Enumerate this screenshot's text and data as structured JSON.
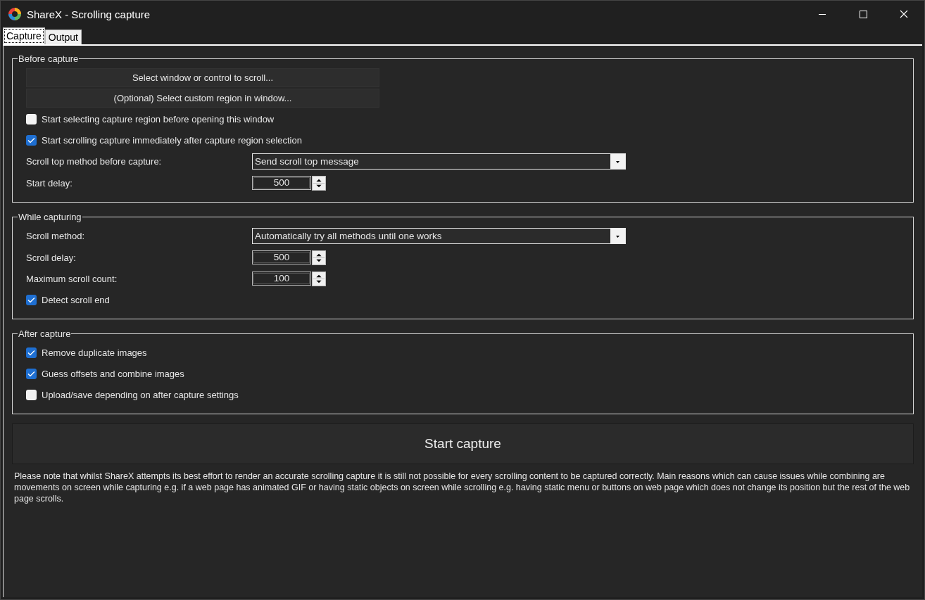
{
  "window": {
    "title": "ShareX - Scrolling capture"
  },
  "tabs": [
    {
      "label": "Capture",
      "selected": true
    },
    {
      "label": "Output",
      "selected": false
    }
  ],
  "groups": [
    {
      "title": "Before capture",
      "items": [
        {
          "kind": "button",
          "label": "Select window or control to scroll..."
        },
        {
          "kind": "button",
          "label": "(Optional) Select custom region in window..."
        },
        {
          "kind": "checkbox",
          "label": "Start selecting capture region before opening this window",
          "checked": false
        },
        {
          "kind": "checkbox",
          "label": "Start scrolling capture immediately after capture region selection",
          "checked": true
        },
        {
          "kind": "select",
          "label": "Scroll top method before capture:",
          "value": "Send scroll top message"
        },
        {
          "kind": "number",
          "label": "Start delay:",
          "value": "500"
        }
      ]
    },
    {
      "title": "While capturing",
      "items": [
        {
          "kind": "select",
          "label": "Scroll method:",
          "value": "Automatically try all methods until one works"
        },
        {
          "kind": "number",
          "label": "Scroll delay:",
          "value": "500"
        },
        {
          "kind": "number",
          "label": "Maximum scroll count:",
          "value": "100"
        },
        {
          "kind": "checkbox",
          "label": "Detect scroll end",
          "checked": true
        }
      ]
    },
    {
      "title": "After capture",
      "items": [
        {
          "kind": "checkbox",
          "label": "Remove duplicate images",
          "checked": true
        },
        {
          "kind": "checkbox",
          "label": "Guess offsets and combine images",
          "checked": true
        },
        {
          "kind": "checkbox",
          "label": "Upload/save depending on after capture settings",
          "checked": false
        }
      ]
    }
  ],
  "start_button": "Start capture",
  "note": "Please note that whilst ShareX attempts its best effort to render an accurate scrolling capture it is still not possible for every scrolling content to be captured correctly. Main reasons which can cause issues while combining are movements on screen while capturing e.g. if a web page has animated GIF or having static objects on screen while scrolling e.g. having static menu or buttons on web page which does not change its position but the rest of the web page scrolls."
}
